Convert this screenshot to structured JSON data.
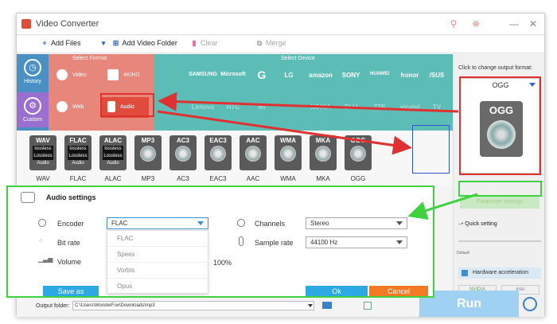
{
  "window": {
    "title": "Video Converter",
    "min": "—",
    "close": "✕",
    "icon1": "⚲",
    "icon2": "⛯"
  },
  "toolbar": {
    "add_files": "Add Files",
    "add_video_folder": "Add Video Folder",
    "clear": "Clear",
    "merge": "Merge"
  },
  "sidebar": {
    "history": "History",
    "custom": "Custom"
  },
  "select_format": {
    "label": "Select Format",
    "items": [
      "Video",
      "4K/HD",
      "Web",
      "Audio"
    ]
  },
  "select_device": {
    "label": "Select Device",
    "brands_row1": [
      "",
      "SAMSUNG",
      "Microsoft",
      "G",
      "LG",
      "amazon",
      "SONY",
      "HUAWEI",
      "honor",
      "/SUS"
    ],
    "brands_row2": [
      "",
      "Lenovo",
      "HTC",
      "MI",
      "",
      "NOKIA",
      "BLU",
      "ZTE",
      "alcatel",
      "TV"
    ]
  },
  "formats": [
    {
      "name": "WAV",
      "lossless": true
    },
    {
      "name": "FLAC",
      "lossless": true
    },
    {
      "name": "ALAC",
      "lossless": true
    },
    {
      "name": "MP3",
      "lossless": false
    },
    {
      "name": "AC3",
      "lossless": false
    },
    {
      "name": "EAC3",
      "lossless": false
    },
    {
      "name": "AAC",
      "lossless": false
    },
    {
      "name": "WMA",
      "lossless": false
    },
    {
      "name": "MKA",
      "lossless": false
    },
    {
      "name": "OGG",
      "lossless": false
    }
  ],
  "lossless_badge": "lossless\nLossless\nAudio",
  "right_panel": {
    "hint": "Click to change output format:",
    "format": "OGG",
    "card_label": "OGG",
    "param_settings": "Parameter settings",
    "quick_setting": "Quick setting",
    "slider_default": "Default",
    "hw_accel": "Hardware acceleration",
    "nvidia": "NVIDIA",
    "intel": "Intel"
  },
  "audio_settings": {
    "title": "Audio settings",
    "encoder_label": "Encoder",
    "encoder_value": "FLAC",
    "encoder_options": [
      "FLAC",
      "Speex",
      "Vorbis",
      "Opus"
    ],
    "bitrate_label": "Bit rate",
    "volume_label": "Volume",
    "volume_value": "100%",
    "channels_label": "Channels",
    "channels_value": "Stereo",
    "sample_rate_label": "Sample rate",
    "sample_rate_value": "44100 Hz",
    "save_as": "Save as",
    "ok": "Ok",
    "cancel": "Cancel"
  },
  "bottom": {
    "output_folder_label": "Output folder:",
    "output_path": "C:\\Users\\WonderFox\\Downloads\\mp3",
    "run": "Run"
  },
  "colors": {
    "annotation_red": "#e03030",
    "annotation_green": "#3ed23e",
    "format_panel": "#e7867b",
    "device_panel": "#5cbcb6",
    "accent_blue": "#2ca8e2",
    "cancel_orange": "#f27a23"
  }
}
